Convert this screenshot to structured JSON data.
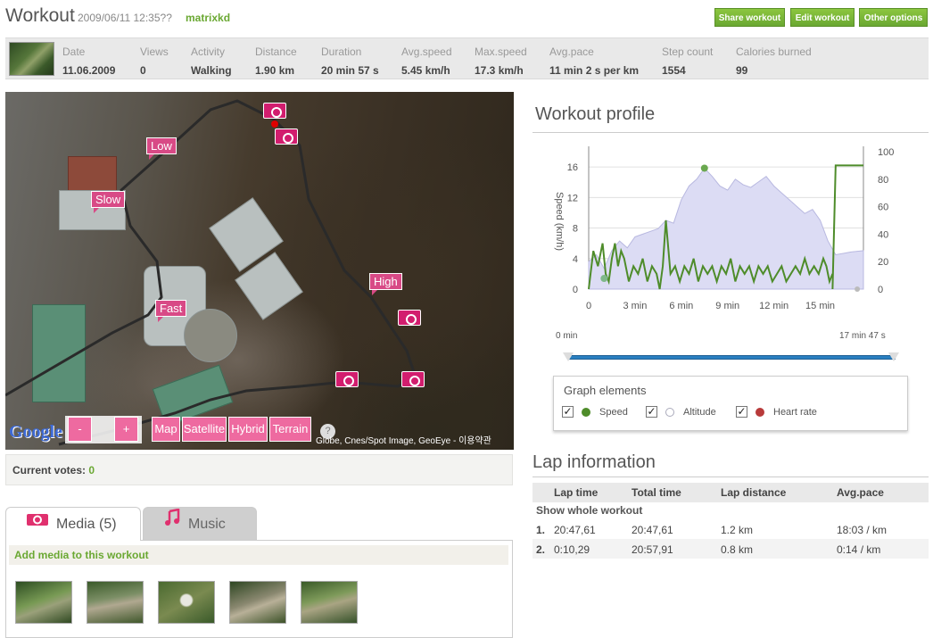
{
  "header": {
    "title": "Workout",
    "datetime": "2009/06/11 12:35??",
    "user": "matrixkd",
    "buttons": [
      "Share workout",
      "Edit workout",
      "Other options"
    ]
  },
  "stats": [
    {
      "label": "Date",
      "value": "11.06.2009"
    },
    {
      "label": "Views",
      "value": "0"
    },
    {
      "label": "Activity",
      "value": "Walking"
    },
    {
      "label": "Distance",
      "value": "1.90 km"
    },
    {
      "label": "Duration",
      "value": "20 min 57 s"
    },
    {
      "label": "Avg.speed",
      "value": "5.45 km/h"
    },
    {
      "label": "Max.speed",
      "value": "17.3 km/h"
    },
    {
      "label": "Avg.pace",
      "value": "11 min 2 s per km"
    },
    {
      "label": "Step count",
      "value": "1554"
    },
    {
      "label": "Calories burned",
      "value": "99"
    }
  ],
  "map": {
    "markers": [
      "Low",
      "Slow",
      "High",
      "Fast"
    ],
    "zoom_out": "-",
    "zoom_in": "+",
    "types": [
      "Map",
      "Satellite",
      "Hybrid",
      "Terrain"
    ],
    "logo": "Google",
    "help": "?",
    "copyright": "Globe, Cnes/Spot Image, GeoEye - 이용약관"
  },
  "votes": {
    "label": "Current votes:",
    "count": "0"
  },
  "tabs": {
    "media": "Media (5)",
    "music": "Music"
  },
  "media": {
    "add_label": "Add media to this workout"
  },
  "profile": {
    "title": "Workout profile",
    "range_start": "0 min",
    "range_end": "17 min 47 s",
    "graph_elements_title": "Graph elements",
    "elements": [
      {
        "label": "Speed",
        "color": "#4e8c2a",
        "checked": true
      },
      {
        "label": "Altitude",
        "color": "#d8d8f0",
        "checked": true
      },
      {
        "label": "Heart rate",
        "color": "#b83a3a",
        "checked": true
      }
    ]
  },
  "chart_data": {
    "type": "line",
    "ylabel": "Speed (km/h)",
    "x_ticks": [
      "0",
      "3 min",
      "6 min",
      "9 min",
      "12 min",
      "15 min"
    ],
    "y_ticks": [
      "0",
      "4",
      "8",
      "12",
      "16"
    ],
    "y2_ticks": [
      "0",
      "20",
      "40",
      "60",
      "80",
      "100"
    ],
    "xlim": [
      0,
      17.8
    ],
    "ylim": [
      0,
      18
    ],
    "y2lim": [
      0,
      100
    ],
    "series": [
      {
        "name": "Speed",
        "color": "#4e8c2a",
        "x": [
          0,
          0.3,
          0.6,
          0.9,
          1.1,
          1.3,
          1.5,
          1.7,
          1.9,
          2.1,
          2.3,
          2.6,
          2.9,
          3.2,
          3.5,
          3.8,
          4.1,
          4.4,
          4.6,
          4.8,
          5.0,
          5.3,
          5.6,
          5.9,
          6.2,
          6.5,
          6.8,
          7.1,
          7.4,
          7.7,
          8.0,
          8.3,
          8.6,
          8.9,
          9.2,
          9.5,
          9.8,
          10.1,
          10.4,
          10.7,
          11.0,
          11.3,
          11.6,
          11.9,
          12.2,
          12.5,
          12.8,
          13.1,
          13.4,
          13.7,
          14.0,
          14.3,
          14.6,
          14.9,
          15.2,
          15.4,
          15.6,
          15.8
        ],
        "values": [
          0,
          5,
          3,
          6,
          2,
          1,
          4,
          6,
          3,
          5,
          4,
          1,
          3,
          2,
          4,
          1,
          3,
          2,
          0,
          3,
          9,
          2,
          3,
          1,
          3,
          2,
          4,
          1,
          3,
          2,
          3,
          1,
          3,
          2,
          4,
          1,
          3,
          2,
          3,
          1,
          3,
          2,
          3,
          1,
          2,
          3,
          1,
          2,
          3,
          2,
          4,
          2,
          3,
          2,
          4,
          3,
          1,
          2
        ]
      },
      {
        "name": "Altitude",
        "color": "#d8d8f0",
        "x": [
          0,
          0.5,
          1.0,
          1.5,
          2.0,
          2.5,
          3.0,
          3.5,
          4.0,
          4.5,
          5.0,
          5.5,
          6.0,
          6.5,
          7.0,
          7.5,
          8.0,
          8.5,
          9.0,
          9.5,
          10.0,
          10.5,
          11.0,
          11.5,
          12.0,
          12.5,
          13.0,
          13.5,
          14.0,
          14.5,
          15.0,
          15.5,
          16.0,
          16.5,
          17.0,
          17.8
        ],
        "values": [
          20,
          25,
          15,
          28,
          35,
          30,
          38,
          40,
          42,
          44,
          50,
          48,
          65,
          75,
          80,
          88,
          82,
          75,
          72,
          80,
          76,
          74,
          78,
          82,
          75,
          70,
          65,
          60,
          55,
          58,
          50,
          35,
          25,
          26,
          27,
          28
        ]
      },
      {
        "name": "Heart rate",
        "color": "#b83a3a",
        "x": [
          15.8,
          16.0,
          17.8
        ],
        "values": [
          0,
          90,
          90
        ]
      }
    ]
  },
  "laps": {
    "title": "Lap information",
    "columns": [
      "Lap time",
      "Total time",
      "Lap distance",
      "Avg.pace"
    ],
    "show_whole": "Show whole workout",
    "rows": [
      {
        "num": "1.",
        "lap_time": "20:47,61",
        "total_time": "20:47,61",
        "distance": "1.2 km",
        "pace": "18:03 / km"
      },
      {
        "num": "2.",
        "lap_time": "0:10,29",
        "total_time": "20:57,91",
        "distance": "0.8 km",
        "pace": "0:14 / km"
      }
    ]
  }
}
